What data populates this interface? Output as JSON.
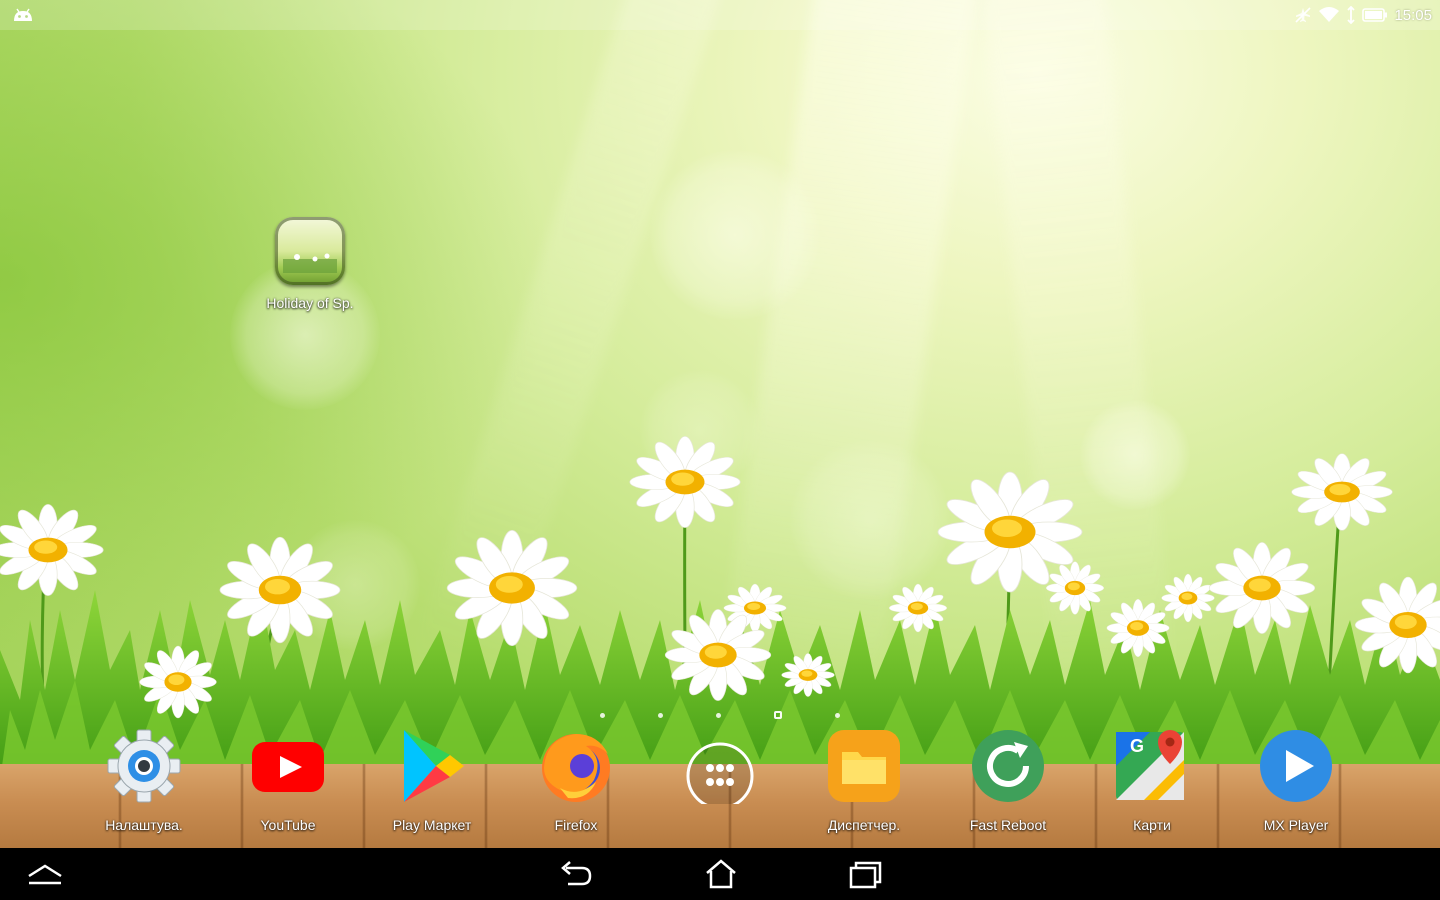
{
  "status_bar": {
    "time": "15:05",
    "left_icon": "android-notification-icon",
    "right_icons": [
      "airplane-off-icon",
      "wifi-icon",
      "signal-icon",
      "battery-icon"
    ]
  },
  "desktop": {
    "shortcut": {
      "label": "Holiday of Sp.",
      "icon": "daisy-wallpaper-app-icon"
    }
  },
  "page_indicator": {
    "pages": 5,
    "current_index": 3
  },
  "dock": {
    "items": [
      {
        "label": "Налаштува.",
        "icon": "settings-gear-icon"
      },
      {
        "label": "YouTube",
        "icon": "youtube-icon"
      },
      {
        "label": "Play Маркет",
        "icon": "play-store-icon"
      },
      {
        "label": "Firefox",
        "icon": "firefox-icon"
      },
      {
        "label": "",
        "icon": "app-drawer-icon"
      },
      {
        "label": "Диспетчер.",
        "icon": "file-manager-icon"
      },
      {
        "label": "Fast Reboot",
        "icon": "reboot-icon"
      },
      {
        "label": "Карти",
        "icon": "maps-icon"
      },
      {
        "label": "MX Player",
        "icon": "mx-player-icon"
      }
    ]
  },
  "nav_bar": {
    "buttons": [
      "collapse-icon",
      "back-icon",
      "home-icon",
      "recents-icon"
    ]
  },
  "colors": {
    "youtube_red": "#ff0000",
    "mx_blue": "#2f8de4",
    "folder_orange": "#f6a21a",
    "reboot_green": "#3fa05a"
  }
}
